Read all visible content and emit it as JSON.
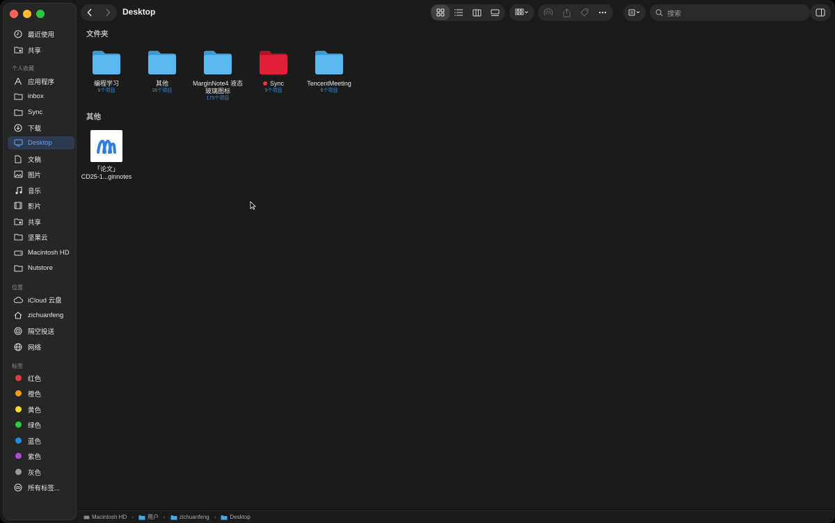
{
  "window": {
    "title": "Desktop"
  },
  "sidebar": {
    "top_items": [
      {
        "label": "最近使用",
        "icon": "clock-icon"
      },
      {
        "label": "共享",
        "icon": "shared-folder-icon"
      }
    ],
    "favorites_title": "个人收藏",
    "favorites": [
      {
        "label": "应用程序",
        "icon": "applications-icon"
      },
      {
        "label": "inbox",
        "icon": "folder-icon"
      },
      {
        "label": "Sync",
        "icon": "folder-icon"
      },
      {
        "label": "下载",
        "icon": "download-icon"
      },
      {
        "label": "Desktop",
        "icon": "desktop-icon",
        "active": true
      },
      {
        "label": "文稿",
        "icon": "document-icon"
      },
      {
        "label": "图片",
        "icon": "photo-icon"
      },
      {
        "label": "音乐",
        "icon": "music-icon"
      },
      {
        "label": "影片",
        "icon": "film-icon"
      },
      {
        "label": "共享",
        "icon": "shared-folder-icon"
      },
      {
        "label": "坚果云",
        "icon": "folder-icon"
      },
      {
        "label": "Macintosh HD",
        "icon": "disk-icon"
      },
      {
        "label": "Nutstore",
        "icon": "folder-icon"
      }
    ],
    "locations_title": "位置",
    "locations": [
      {
        "label": "iCloud 云盘",
        "icon": "cloud-icon"
      },
      {
        "label": "zichuanfeng",
        "icon": "home-icon"
      },
      {
        "label": "隔空投送",
        "icon": "airdrop-icon"
      },
      {
        "label": "网络",
        "icon": "network-icon"
      }
    ],
    "tags_title": "标签",
    "tags": [
      {
        "label": "红色",
        "color": "#e5383b"
      },
      {
        "label": "橙色",
        "color": "#f39c12"
      },
      {
        "label": "黄色",
        "color": "#f4e021"
      },
      {
        "label": "绿色",
        "color": "#2ecc40"
      },
      {
        "label": "蓝色",
        "color": "#1e88e5"
      },
      {
        "label": "紫色",
        "color": "#b04bd8"
      },
      {
        "label": "灰色",
        "color": "#9a9a9a"
      }
    ],
    "all_tags_label": "所有标签..."
  },
  "toolbar": {
    "search_placeholder": "搜索"
  },
  "sections": {
    "folders_title": "文件夹",
    "others_title": "其他"
  },
  "folders": [
    {
      "name": "编程学习",
      "count": "6个项目",
      "color": "blue"
    },
    {
      "name": "其他",
      "count": "36个项目",
      "color": "blue"
    },
    {
      "name": "MarginNote4 液态玻璃图标",
      "name_line1": "MarginNote4 液态",
      "name_line2": "玻璃图标",
      "count": "175个项目",
      "color": "blue"
    },
    {
      "name": "Sync",
      "count": "9个项目",
      "color": "red",
      "tag_color": "#e5383b"
    },
    {
      "name": "TencentMeeting",
      "count": "6个项目",
      "color": "blue"
    }
  ],
  "files": [
    {
      "line1": "「论文」",
      "line2": "CD25-1...ginnotes"
    }
  ],
  "path_bar": {
    "items": [
      "Macintosh HD",
      "用户",
      "zichuanfeng",
      "Desktop"
    ]
  }
}
